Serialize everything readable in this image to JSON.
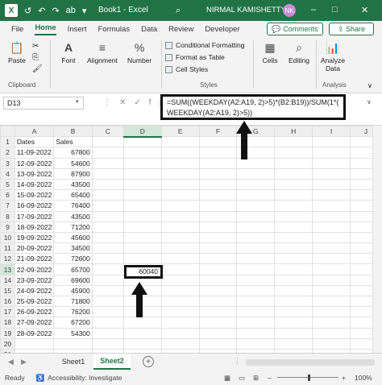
{
  "titlebar": {
    "app_icon": "X",
    "title": "Book1  -  Excel",
    "user": "NIRMAL KAMISHETTY",
    "avatar": "NK"
  },
  "menu": [
    "File",
    "Home",
    "Insert",
    "Formulas",
    "Data",
    "Review",
    "Developer"
  ],
  "menu_active": "Home",
  "buttons": {
    "comments": "Comments",
    "share": "Share"
  },
  "ribbon": {
    "paste": "Paste",
    "clipboard": "Clipboard",
    "font": "Font",
    "alignment": "Alignment",
    "number": "Number",
    "conditional_formatting": "Conditional Formatting",
    "format_as_table": "Format as Table",
    "cell_styles": "Cell Styles",
    "styles": "Styles",
    "cells": "Cells",
    "editing": "Editing",
    "analyze_data": "Analyze Data",
    "analysis": "Analysis"
  },
  "formula_bar": {
    "name_box": "D13",
    "formula": "=SUM((WEEKDAY(A2:A19, 2)>5)*(B2:B19))/SUM(1*(\nWEEKDAY(A2:A19, 2)>5))"
  },
  "columns": [
    "A",
    "B",
    "C",
    "D",
    "E",
    "F",
    "G",
    "H",
    "I",
    "J"
  ],
  "rows": [
    [
      "Dates",
      "Sales"
    ],
    [
      "11-09-2022",
      "67800"
    ],
    [
      "12-09-2022",
      "54600"
    ],
    [
      "13-09-2022",
      "87900"
    ],
    [
      "14-09-2022",
      "43500"
    ],
    [
      "15-09-2022",
      "65400"
    ],
    [
      "16-09-2022",
      "76400"
    ],
    [
      "17-09-2022",
      "43500"
    ],
    [
      "18-09-2022",
      "71200"
    ],
    [
      "19-09-2022",
      "45600"
    ],
    [
      "20-09-2022",
      "34500"
    ],
    [
      "21-09-2022",
      "72600"
    ],
    [
      "22-09-2022",
      "65700"
    ],
    [
      "23-09-2022",
      "69600"
    ],
    [
      "24-09-2022",
      "45900"
    ],
    [
      "25-09-2022",
      "71800"
    ],
    [
      "26-09-2022",
      "76200"
    ],
    [
      "27-09-2022",
      "67200"
    ],
    [
      "28-09-2022",
      "54300"
    ],
    [
      "",
      ""
    ],
    [
      "",
      ""
    ],
    [
      "",
      ""
    ]
  ],
  "selected_cell_value": "60040",
  "sheets": [
    "Sheet1",
    "Sheet2"
  ],
  "active_sheet": "Sheet2",
  "status": {
    "ready": "Ready",
    "accessibility": "Accessibility: Investigate",
    "zoom": "100%"
  },
  "colors": {
    "accent": "#217346"
  }
}
